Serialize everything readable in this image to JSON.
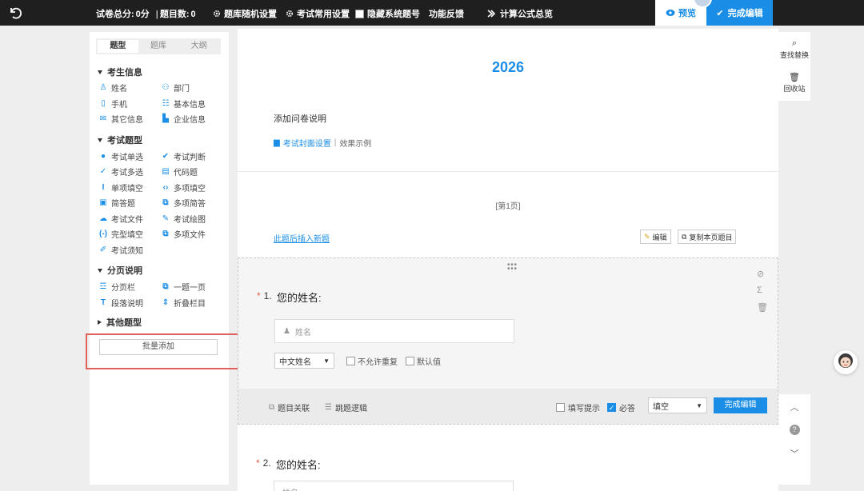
{
  "topbar": {
    "total_score_label": "试卷总分:",
    "total_score_value": "0分",
    "sep": "|",
    "question_count_label": "题目数:",
    "question_count_value": "0",
    "menu": {
      "random_settings": "题库随机设置",
      "common_settings": "考试常用设置",
      "hide_numbers": "隐藏系统题号",
      "feedback": "功能反馈",
      "formula_display": "计算公式总览"
    },
    "preview": "预览",
    "finish_edit": "完成编辑"
  },
  "sidebar": {
    "tabs": [
      "题型",
      "题库",
      "大纲"
    ],
    "active_tab": "题型",
    "groups": {
      "candidate_info": {
        "title": "考生信息",
        "items": [
          "姓名",
          "部门",
          "手机",
          "基本信息",
          "其它信息",
          "企业信息"
        ]
      },
      "exam_types": {
        "title": "考试题型",
        "items": [
          "考试单选",
          "考试判断",
          "考试多选",
          "代码题",
          "单项填空",
          "多项填空",
          "简答题",
          "多项简答",
          "考试文件",
          "考试绘图",
          "完型填空",
          "多项文件",
          "考试须知"
        ]
      },
      "pagination": {
        "title": "分页说明",
        "items": [
          "分页栏",
          "一题一页",
          "段落说明",
          "折叠栏目"
        ]
      },
      "other": {
        "title": "其他题型"
      }
    },
    "batch_add": "批量添加"
  },
  "document": {
    "title": "2026",
    "intro": "添加问卷说明",
    "cover_settings": "考试封面设置",
    "pipe": "|",
    "effect_example": "效果示例",
    "page_label": "[第1页]",
    "insert_new": "此题后插入新题",
    "edit": "编辑",
    "copy_page": "复制本页题目"
  },
  "question1": {
    "number": "1.",
    "required_mark": "*",
    "title": "您的姓名:",
    "placeholder": "姓名",
    "name_type": "中文姓名",
    "no_duplicate": "不允许重复",
    "default_value": "默认值",
    "relation": "题目关联",
    "jump_logic": "跳题逻辑",
    "fill_hint": "填写提示",
    "required": "必答",
    "fill_type": "填空",
    "finish": "完成编辑"
  },
  "question2": {
    "number": "2.",
    "required_mark": "*",
    "title": "您的姓名:",
    "placeholder": "姓名"
  },
  "right_tools": {
    "find_replace": "查找替换",
    "recycle_bin": "回收站",
    "help": "?"
  },
  "colors": {
    "accent": "#1a8ee6",
    "topbar": "#1f1f1f",
    "highlight_box": "#e0605a",
    "required": "#e65a4a"
  }
}
